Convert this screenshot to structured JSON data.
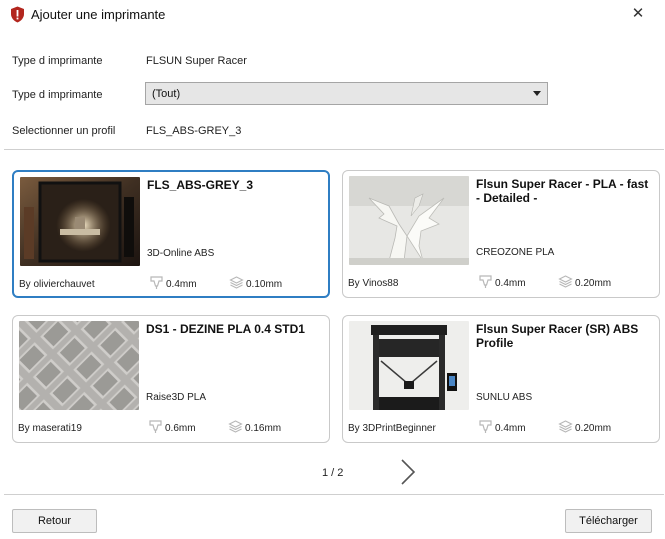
{
  "window": {
    "title": "Ajouter une imprimante",
    "close_glyph": "✕",
    "icon": "shield-exclamation-icon",
    "accent_color": "#b3261e"
  },
  "form": {
    "printer_type_label": "Type d imprimante",
    "printer_type_value": "FLSUN Super Racer",
    "printer_type_filter_label": "Type d imprimante",
    "printer_type_filter_value": "(Tout)",
    "profile_label": "Selectionner un profil",
    "profile_value": "FLS_ABS-GREY_3"
  },
  "profiles": [
    {
      "title": "FLS_ABS-GREY_3",
      "material": "3D-Online ABS",
      "author": "By olivierchauvet",
      "nozzle": "0.4mm",
      "layer": "0.10mm",
      "selected": true,
      "thumbnail": "printer-enclosure-photo"
    },
    {
      "title": "Flsun Super Racer - PLA - fast - Detailed -",
      "material": "CREOZONE PLA",
      "author": "By Vinos88",
      "nozzle": "0.4mm",
      "layer": "0.20mm",
      "selected": false,
      "thumbnail": "dragon-print-photo"
    },
    {
      "title": "DS1 - DEZINE PLA 0.4 STD1",
      "material": "Raise3D PLA",
      "author": "By maserati19",
      "nozzle": "0.6mm",
      "layer": "0.16mm",
      "selected": false,
      "thumbnail": "grid-infill-photo"
    },
    {
      "title": "Flsun Super Racer (SR) ABS Profile",
      "material": "SUNLU ABS",
      "author": "By 3DPrintBeginner",
      "nozzle": "0.4mm",
      "layer": "0.20mm",
      "selected": false,
      "thumbnail": "delta-printer-photo"
    }
  ],
  "pagination": {
    "label": "1 / 2",
    "current": 1,
    "total": 2
  },
  "footer": {
    "back_label": "Retour",
    "download_label": "Télécharger"
  },
  "colors": {
    "selected_border": "#2f7ec3",
    "card_border": "#c9c9c9",
    "select_background": "#e6e6e6"
  }
}
